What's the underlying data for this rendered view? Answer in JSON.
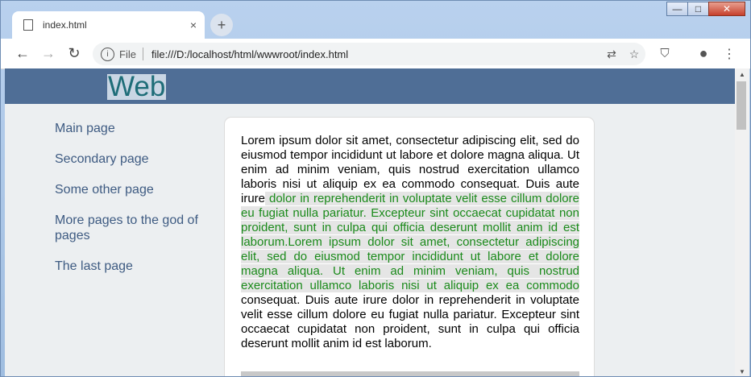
{
  "browser": {
    "tab_title": "index.html",
    "tab_close": "×",
    "new_tab": "+",
    "url_scheme": "File",
    "url": "file:///D:/localhost/html/wwwroot/index.html",
    "window_controls": [
      "—",
      "□",
      "✕"
    ]
  },
  "page": {
    "logo": "Web",
    "nav": [
      {
        "label": "Main page"
      },
      {
        "label": "Secondary page"
      },
      {
        "label": "Some other page"
      },
      {
        "label": "More pages to the god of pages"
      },
      {
        "label": "The last page"
      }
    ],
    "content": {
      "p1": "Lorem ipsum dolor sit amet, consectetur adipiscing elit, sed do eiusmod tempor incididunt ut labore et dolore magna aliqua. Ut enim ad minim veniam, quis nostrud exercitation ullamco laboris nisi ut aliquip ex ea commodo consequat. Duis aute irure",
      "highlight": " dolor in reprehenderit in voluptate velit esse cillum dolore eu fugiat nulla pariatur. Excepteur sint occaecat cupidatat non proident, sunt in culpa qui officia deserunt mollit anim id est laborum.Lorem ipsum dolor sit amet, consectetur adipiscing elit, sed do eiusmod tempor incididunt ut labore et dolore magna aliqua. Ut enim ad minim veniam, quis nostrud exercitation ullamco laboris nisi ut aliquip ex ea commodo",
      "p2": " consequat. Duis aute irure dolor in reprehenderit in voluptate velit esse cillum dolore eu fugiat nulla pariatur. Excepteur sint occaecat cupidatat non proident, sunt in culpa qui officia deserunt mollit anim id est laborum."
    }
  },
  "colors": {
    "header": "#4f6e96",
    "logo_text": "#1e6d78",
    "nav_link": "#3e5b82",
    "highlight_text": "#1a8a1a"
  }
}
